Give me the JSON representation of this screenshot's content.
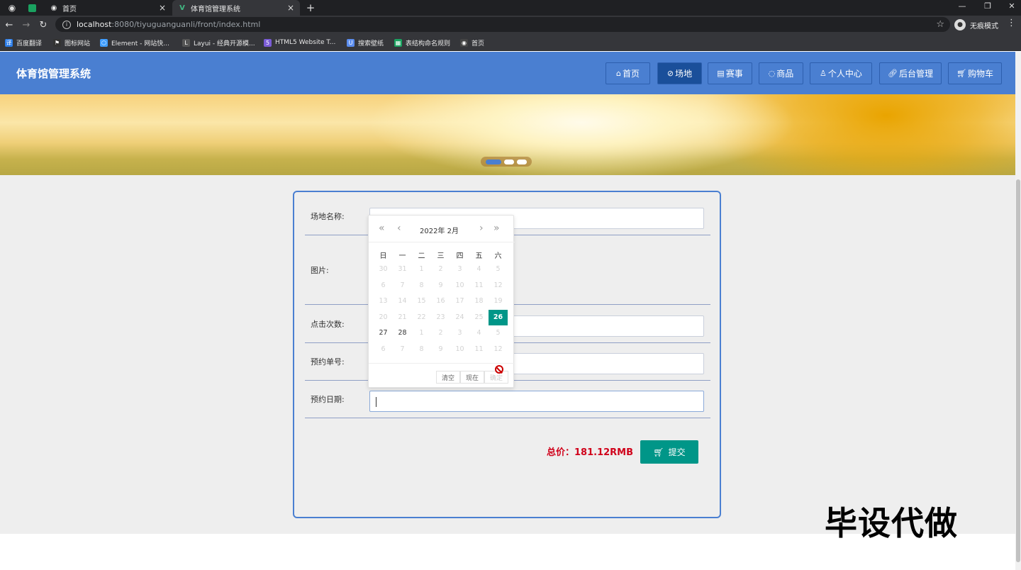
{
  "browser": {
    "tabs": [
      {
        "label": "首页",
        "active": false
      },
      {
        "label": "体育馆管理系统",
        "active": true
      }
    ],
    "url_host": "localhost",
    "url_path": ":8080/tiyuguanguanli/front/index.html",
    "incognito_label": "无痕模式",
    "bookmarks": [
      "百度翻译",
      "图标网站",
      "Element - 网站快...",
      "Layui - 经典开源模...",
      "HTML5 Website T...",
      "搜索壁纸",
      "表结构命名规则",
      "首页"
    ]
  },
  "header": {
    "brand": "体育馆管理系统",
    "nav": [
      {
        "label": "首页",
        "icon": "home-icon",
        "active": false
      },
      {
        "label": "场地",
        "icon": "venue-icon",
        "active": true
      },
      {
        "label": "赛事",
        "icon": "event-icon",
        "active": false
      },
      {
        "label": "商品",
        "icon": "goods-icon",
        "active": false
      },
      {
        "label": "个人中心",
        "icon": "user-icon",
        "active": false
      },
      {
        "label": "后台管理",
        "icon": "link-icon",
        "active": false
      },
      {
        "label": "购物车",
        "icon": "cart-icon",
        "active": false
      }
    ]
  },
  "form": {
    "venue_name_label": "场地名称:",
    "image_label": "图片:",
    "clicks_label": "点击次数:",
    "booking_no_label": "预约单号:",
    "booking_date_label": "预约日期:",
    "total_label": "总价：181.12RMB",
    "submit_label": "提交"
  },
  "datepicker": {
    "year_month": "2022年  2月",
    "weekdays": [
      "日",
      "一",
      "二",
      "三",
      "四",
      "五",
      "六"
    ],
    "weeks": [
      [
        [
          "30",
          "dis"
        ],
        [
          "31",
          "dis"
        ],
        [
          "1",
          "dis"
        ],
        [
          "2",
          "dis"
        ],
        [
          "3",
          "dis"
        ],
        [
          "4",
          "dis"
        ],
        [
          "5",
          "dis"
        ]
      ],
      [
        [
          "6",
          "dis"
        ],
        [
          "7",
          "dis"
        ],
        [
          "8",
          "dis"
        ],
        [
          "9",
          "dis"
        ],
        [
          "10",
          "dis"
        ],
        [
          "11",
          "dis"
        ],
        [
          "12",
          "dis"
        ]
      ],
      [
        [
          "13",
          "dis"
        ],
        [
          "14",
          "dis"
        ],
        [
          "15",
          "dis"
        ],
        [
          "16",
          "dis"
        ],
        [
          "17",
          "dis"
        ],
        [
          "18",
          "dis"
        ],
        [
          "19",
          "dis"
        ]
      ],
      [
        [
          "20",
          "dis"
        ],
        [
          "21",
          "dis"
        ],
        [
          "22",
          "dis"
        ],
        [
          "23",
          "dis"
        ],
        [
          "24",
          "dis"
        ],
        [
          "25",
          "dis"
        ],
        [
          "26",
          "sel"
        ]
      ],
      [
        [
          "27",
          "en"
        ],
        [
          "28",
          "en"
        ],
        [
          "1",
          "dis"
        ],
        [
          "2",
          "dis"
        ],
        [
          "3",
          "dis"
        ],
        [
          "4",
          "dis"
        ],
        [
          "5",
          "dis"
        ]
      ],
      [
        [
          "6",
          "dis"
        ],
        [
          "7",
          "dis"
        ],
        [
          "8",
          "dis"
        ],
        [
          "9",
          "dis"
        ],
        [
          "10",
          "dis"
        ],
        [
          "11",
          "dis"
        ],
        [
          "12",
          "dis"
        ]
      ]
    ],
    "clear_label": "清空",
    "now_label": "现在",
    "confirm_label": "确定"
  },
  "watermark": "毕设代做",
  "colors": {
    "header_bg": "#4a7fd1",
    "active_nav": "#1a4f9a",
    "accent_green": "#009688",
    "total_red": "#d0021b"
  }
}
